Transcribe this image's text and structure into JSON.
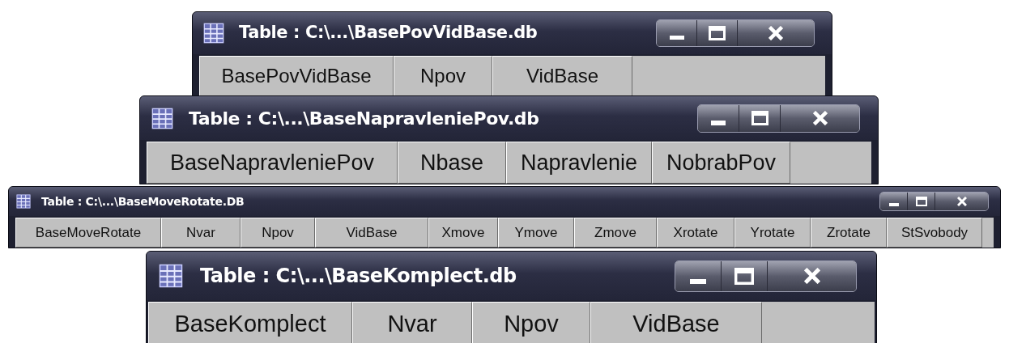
{
  "windows": [
    {
      "title": "Table : C:\\...\\BasePovVidBase.db",
      "columns": [
        "BasePovVidBase",
        "Npov",
        "VidBase"
      ]
    },
    {
      "title": "Table : C:\\...\\BaseNapravleniePov.db",
      "columns": [
        "BaseNapravleniePov",
        "Nbase",
        "Napravlenie",
        "NobrabPov"
      ]
    },
    {
      "title": "Table : C:\\...\\BaseMoveRotate.DB",
      "columns": [
        "BaseMoveRotate",
        "Nvar",
        "Npov",
        "VidBase",
        "Xmove",
        "Ymove",
        "Zmove",
        "Xrotate",
        "Yrotate",
        "Zrotate",
        "StSvobody"
      ]
    },
    {
      "title": "Table : C:\\...\\BaseKomplect.db",
      "columns": [
        "BaseKomplect",
        "Nvar",
        "Npov",
        "VidBase"
      ]
    }
  ]
}
